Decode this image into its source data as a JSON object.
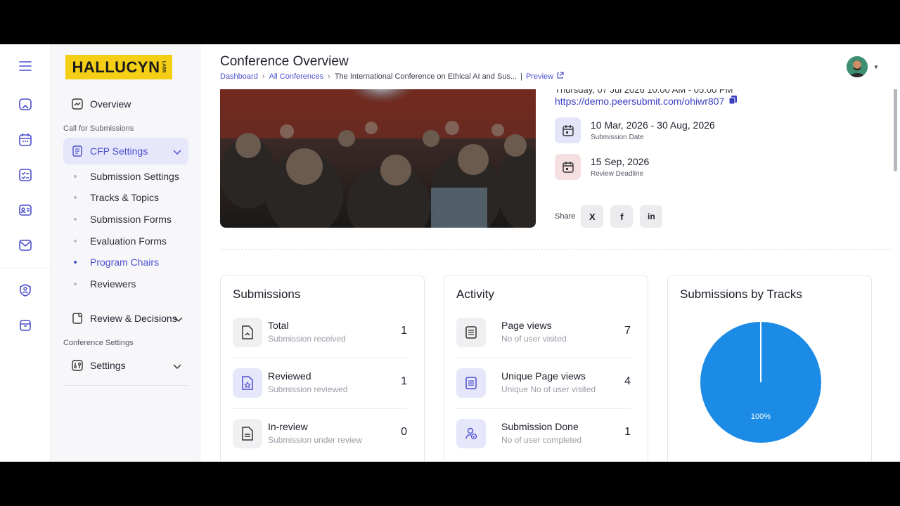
{
  "app": {
    "logo_text": "HALLUCYN",
    "logo_sub": "LABS"
  },
  "header": {
    "title": "Conference Overview",
    "breadcrumbs": [
      "Dashboard",
      "All Conferences",
      "The International Conference on Ethical AI and Sus..."
    ],
    "preview_label": "Preview"
  },
  "rail": {
    "icons": [
      "menu-icon",
      "home-icon",
      "calendar-icon",
      "checklist-icon",
      "contact-card-icon",
      "mail-icon",
      "user-shield-icon",
      "archive-icon"
    ]
  },
  "sidebar": {
    "overview": "Overview",
    "section_cfp": "Call for Submissions",
    "cfp_settings": "CFP Settings",
    "sub_items": [
      {
        "label": "Submission Settings",
        "active": false
      },
      {
        "label": "Tracks & Topics",
        "active": false
      },
      {
        "label": "Submission Forms",
        "active": false
      },
      {
        "label": "Evaluation Forms",
        "active": false
      },
      {
        "label": "Program Chairs",
        "active": true
      },
      {
        "label": "Reviewers",
        "active": false
      }
    ],
    "review_decisions": "Review & Decisions",
    "section_conf": "Conference Settings",
    "settings": "Settings"
  },
  "overview": {
    "partial_text": "Thursday, 07 Jul 2026 10:00 AM - 05:00 PM",
    "url": "https://demo.peersubmit.com/ohiwr807",
    "submission_date": "10 Mar, 2026 - 30 Aug, 2026",
    "submission_date_label": "Submission Date",
    "review_deadline": "15 Sep, 2026",
    "review_deadline_label": "Review Deadline",
    "share_label": "Share",
    "share_buttons": [
      "X",
      "f",
      "in"
    ]
  },
  "submissions": {
    "title": "Submissions",
    "items": [
      {
        "label": "Total",
        "sub": "Submission received",
        "value": "1"
      },
      {
        "label": "Reviewed",
        "sub": "Submission reviewed",
        "value": "1"
      },
      {
        "label": "In-review",
        "sub": "Submission under review",
        "value": "0"
      }
    ]
  },
  "activity": {
    "title": "Activity",
    "items": [
      {
        "label": "Page views",
        "sub": "No of user visited",
        "value": "7"
      },
      {
        "label": "Unique Page views",
        "sub": "Unique No of user visited",
        "value": "4"
      },
      {
        "label": "Submission Done",
        "sub": "No of user completed",
        "value": "1"
      }
    ]
  },
  "tracks": {
    "title": "Submissions by Tracks"
  },
  "chart_data": {
    "type": "pie",
    "title": "Submissions by Tracks",
    "slices": [
      {
        "value": 100,
        "label": "100%"
      }
    ],
    "colors": [
      "#1b8be6"
    ]
  },
  "colors": {
    "accent": "#4a4fce",
    "logo_bg": "#f4cf16",
    "pie": "#1b8be6",
    "active_bg": "#e6e7fb"
  }
}
